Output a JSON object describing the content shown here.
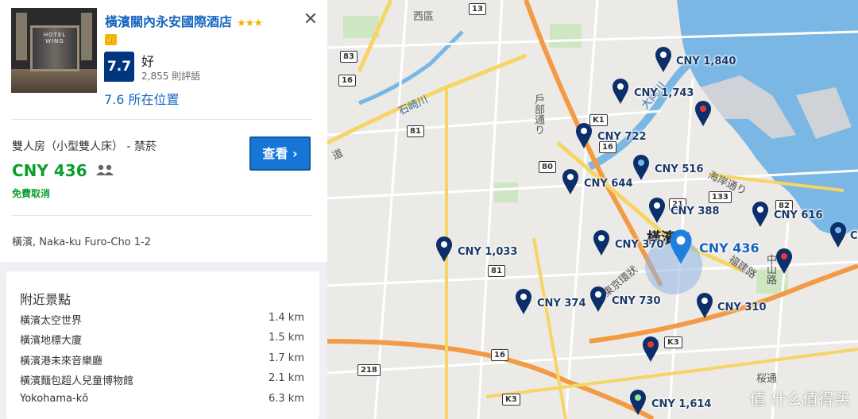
{
  "hotel": {
    "name": "橫濱關內永安國際酒店",
    "stars": "★★★",
    "thumb_icon": "thumbs-up-icon",
    "photo_sign": "HOTEL WING",
    "score": "7.7",
    "rating_word": "好",
    "review_count": "2,855 則評語",
    "location_score": "7.6 所在位置",
    "room_type": "雙人房（小型雙人床） - 禁菸",
    "price": "CNY 436",
    "free_cancel": "免費取消",
    "view_button": "查看",
    "address": "橫濱, Naka-ku Furo-Cho 1-2",
    "close_icon": "close-icon"
  },
  "nearby": {
    "title": "附近景點",
    "items": [
      {
        "name": "橫濱太空世界",
        "distance": "1.4 km"
      },
      {
        "name": "橫濱地標大廈",
        "distance": "1.5 km"
      },
      {
        "name": "橫濱港未來音樂廳",
        "distance": "1.7 km"
      },
      {
        "name": "橫濱麵包超人兒童博物館",
        "distance": "2.1 km"
      },
      {
        "name": "Yokohama-kō",
        "distance": "6.3 km"
      }
    ]
  },
  "map": {
    "price_labels": [
      "CNY 1,840",
      "CNY 1,743",
      "CNY 722",
      "CNY 516",
      "CNY 644",
      "CNY 388",
      "CNY 616",
      "CNY 1,033",
      "CNY 370",
      "CNY 436",
      "CNY 374",
      "CNY 730",
      "CNY 310",
      "CNY 1,614",
      "C"
    ],
    "place_labels": [
      "西區",
      "戶部通り",
      "石崎川",
      "大岡川",
      "海岸通り",
      "橫濱市",
      "東京環狀",
      "福建路",
      "中山路",
      "桜通",
      "道"
    ],
    "road_numbers": [
      "13",
      "83",
      "16",
      "81",
      "80",
      "K1",
      "16",
      "133",
      "21",
      "82",
      "81",
      "16",
      "K3",
      "218",
      "K3"
    ]
  },
  "watermark": "值 什么值得买",
  "colors": {
    "brand_blue": "#003580",
    "link_blue": "#1565c0",
    "price_green": "#0a9e2f",
    "button_blue": "#1676d6",
    "pin_navy": "#0b2f6b"
  }
}
